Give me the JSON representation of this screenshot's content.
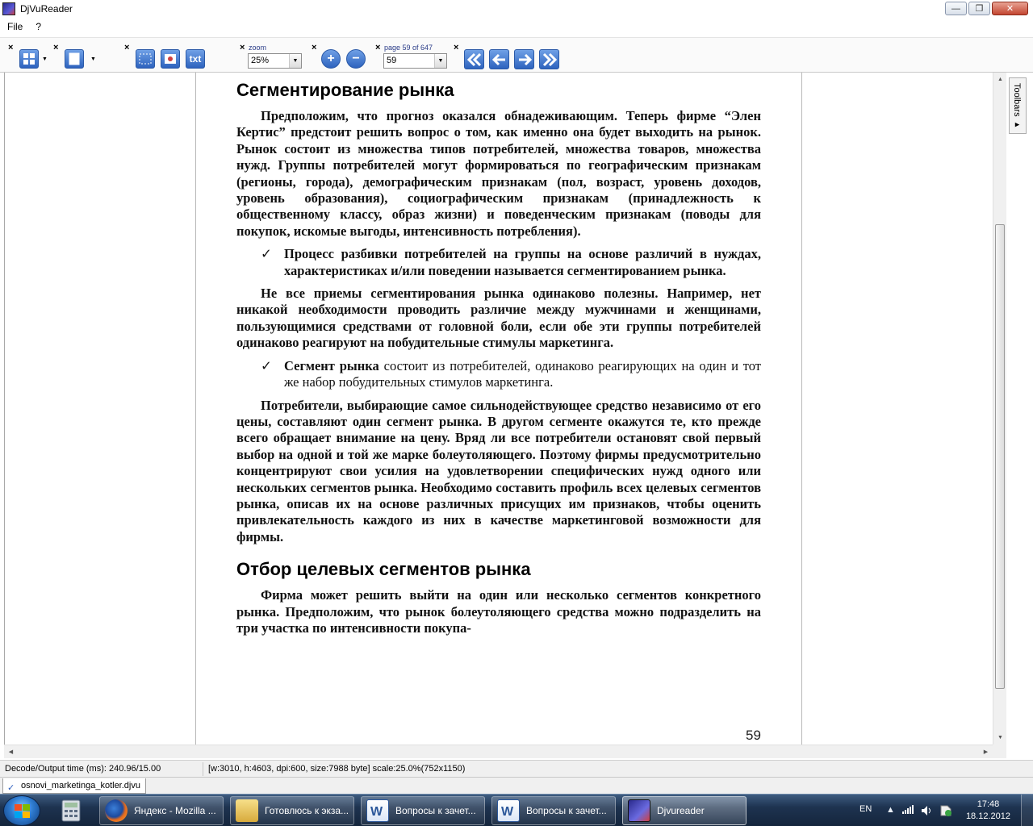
{
  "window": {
    "title": "DjVuReader",
    "buttons": {
      "minimize": "—",
      "maximize": "❐",
      "close": "✕"
    }
  },
  "menu": {
    "items": [
      "File",
      "?"
    ]
  },
  "toolbar": {
    "close_glyph": "×",
    "zoom": {
      "label": "zoom",
      "value": "25%"
    },
    "page": {
      "label": "page 59 of 647",
      "value": "59"
    },
    "text_button": "txt",
    "zoom_in_glyph": "+",
    "zoom_out_glyph": "−"
  },
  "sidebar_tab": {
    "label": "Toolbars ▸"
  },
  "page": {
    "heading1": "Сегментирование рынка",
    "para1": "Предположим, что прогноз оказался обнадеживающим. Теперь фирме “Элен Кертис” предстоит решить вопрос о том, как именно она будет выходить на рынок. Рынок состоит из множества типов потребителей, множества товаров, множества нужд. Группы потребителей могут формироваться по географическим признакам (регионы, города), демографическим признакам (пол, возраст, уровень доходов, уровень образования), социографическим признакам (принадлежность к общественному классу, образ жизни) и поведенческим признакам (поводы для покупок, искомые выгоды, интенсивность потребления).",
    "bullet1": {
      "check": "✓",
      "text": "Процесс разбивки потребителей на группы на основе различий в нуждах, характеристиках и/или поведении называется ",
      "bold": "сегментированием рынка",
      "end": "."
    },
    "para2": "Не все приемы сегментирования рынка одинаково полезны. Например, нет никакой необходимости проводить различие между мужчинами и женщинами, пользующимися средствами от головной боли, если обе эти группы потребителей одинаково реагируют на побудительные стимулы маркетинга.",
    "bullet2": {
      "check": "✓",
      "bold": "Сегмент рынка",
      "text": " состоит из потребителей, одинаково реагирующих на один и тот же набор побудительных стимулов маркетинга."
    },
    "para3": "Потребители, выбирающие самое сильнодействующее средство независимо от его цены, составляют один сегмент рынка. В другом сегменте окажутся те, кто прежде всего обращает внимание на цену. Вряд ли все потребители остановят свой первый выбор на одной и той же марке болеутоляющего. Поэтому фирмы предусмотрительно концентрируют свои усилия на удовлетворении специфических нужд одного или нескольких сегментов рынка. Необходимо составить профиль всех целевых сегментов рынка, описав их на основе различных присущих им признаков, чтобы оценить привлекательность каждого из них в качестве маркетинговой возможности для фирмы.",
    "heading2": "Отбор целевых сегментов рынка",
    "para4": "Фирма может решить выйти на один или несколько сегментов конкретного рынка. Предположим, что рынок болеутоляющего средства можно подразделить на три участка по интенсивности покупа-",
    "number": "59"
  },
  "status": {
    "decode_time": "Decode/Output time (ms): 240.96/15.00",
    "info": "[w:3010, h:4603, dpi:600, size:7988 byte] scale:25.0%(752x1150)"
  },
  "file_tab": {
    "name": "osnovi_marketinga_kotler.djvu"
  },
  "taskbar": {
    "tasks": [
      {
        "label": "Яндекс - Mozilla ...",
        "icon": "firefox-icon"
      },
      {
        "label": "Готовлюсь к экза...",
        "icon": "folder-icon"
      },
      {
        "label": "Вопросы к зачет...",
        "icon": "word-icon"
      },
      {
        "label": "Вопросы к зачет...",
        "icon": "word-icon"
      },
      {
        "label": "Djvureader",
        "icon": "djvureader-icon"
      }
    ],
    "language": "EN",
    "time": "17:48",
    "date": "18.12.2012"
  },
  "colors": {
    "toolbar_button": "#2e63be",
    "taskbar": "#1e3350",
    "close_button": "#c34631"
  }
}
